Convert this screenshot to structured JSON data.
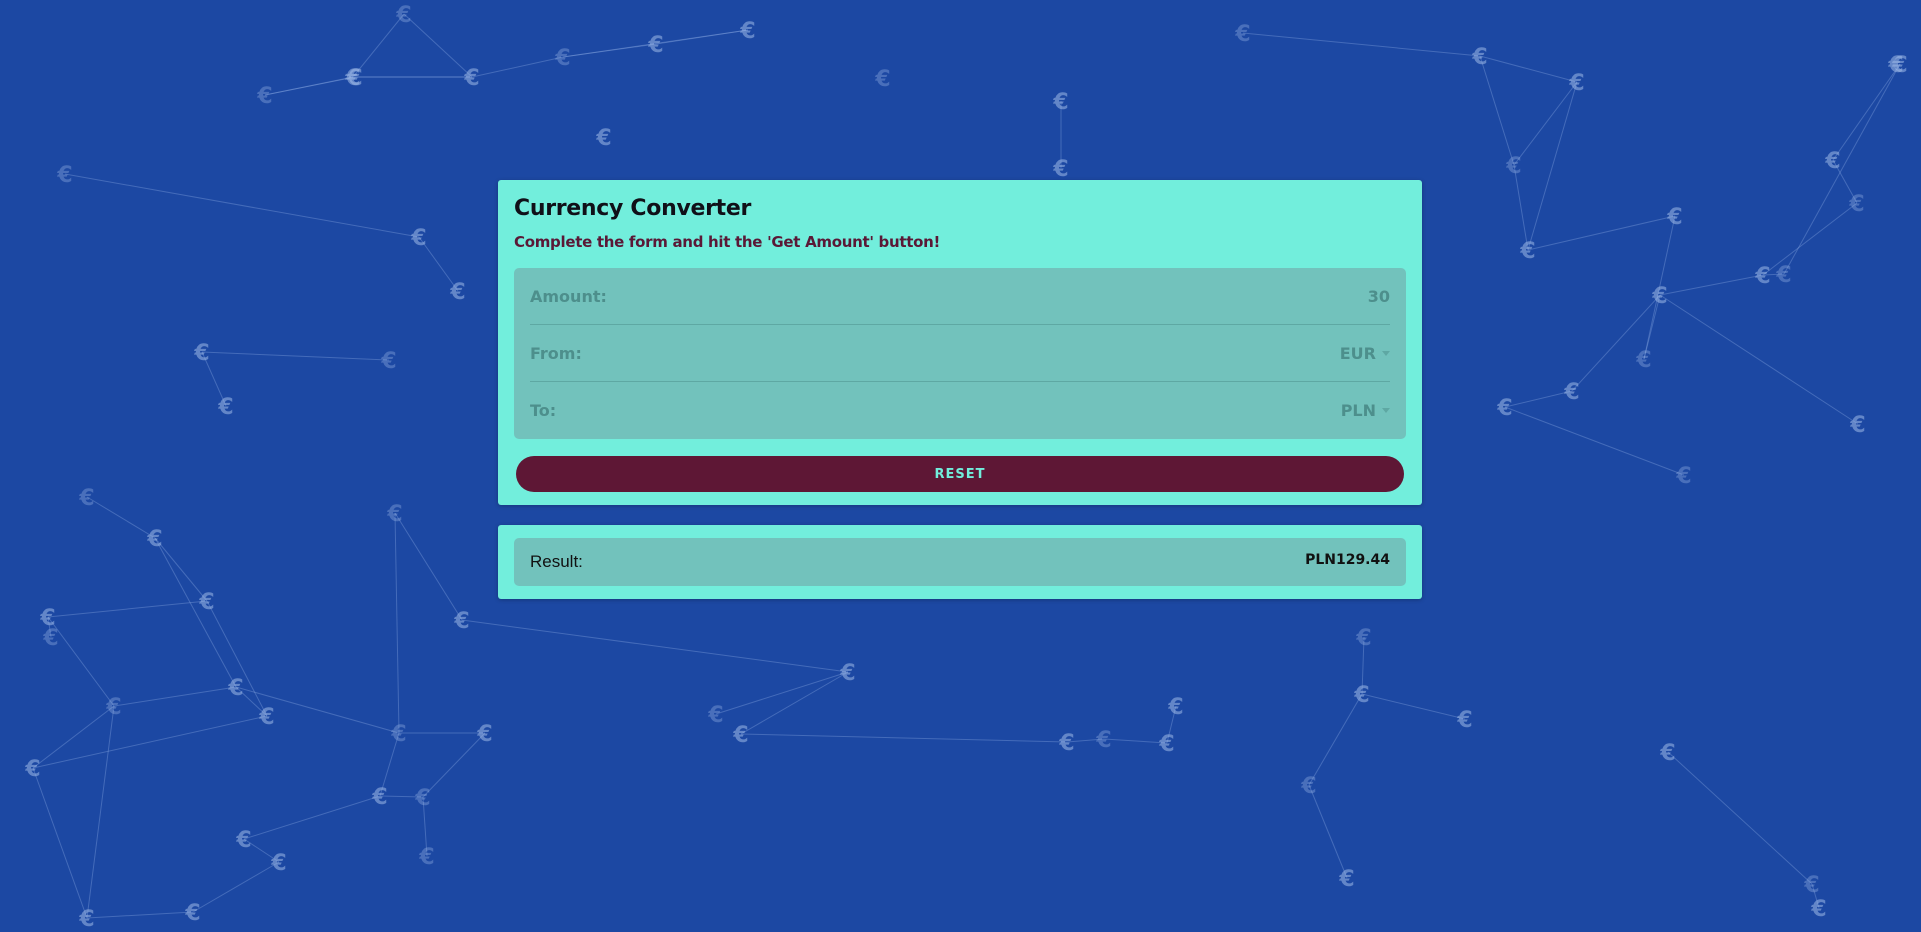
{
  "app": {
    "title": "Currency Converter",
    "subtitle": "Complete the form and hit the 'Get Amount' button!"
  },
  "form": {
    "amount_label": "Amount:",
    "amount_value": "30",
    "from_label": "From:",
    "from_value": "EUR",
    "to_label": "To:",
    "to_value": "PLN"
  },
  "actions": {
    "reset_label": "RESET"
  },
  "result": {
    "label": "Result:",
    "value": "PLN129.44"
  },
  "background": {
    "decoration_icon": "euro-icon",
    "network_glyph": "€"
  },
  "colors": {
    "background": "#1c48a3",
    "card": "#72eedc",
    "field_box": "#72c2bc",
    "button": "#5e1735",
    "subtitle": "#5a1836"
  }
}
